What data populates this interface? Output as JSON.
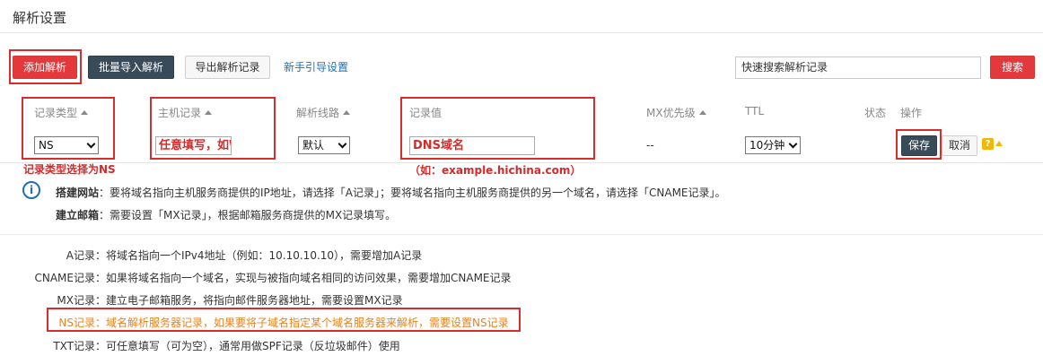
{
  "page": {
    "title": "解析设置"
  },
  "toolbar": {
    "add_label": "添加解析",
    "batch_import_label": "批量导入解析",
    "export_label": "导出解析记录",
    "guide_label": "新手引导设置",
    "search_value": "快速搜索解析记录",
    "search_button_label": "搜索"
  },
  "table": {
    "headers": {
      "record_type": "记录类型",
      "host": "主机记录",
      "line": "解析线路",
      "value": "记录值",
      "mx_priority": "MX优先级",
      "ttl": "TTL",
      "status": "状态",
      "actions": "操作"
    },
    "edit_row": {
      "record_type": "NS",
      "host": "任意填写，如WWW",
      "line": "默认",
      "value": "DNS域名",
      "mx_priority": "--",
      "ttl": "10分钟",
      "save_label": "保存",
      "cancel_label": "取消",
      "help_glyph": "?"
    }
  },
  "annotations": {
    "record_type_note": "记录类型选择为NS",
    "value_note": "（如：example.hichina.com）"
  },
  "info": {
    "icon_glyph": "i",
    "website_title": "搭建网站",
    "website_text": "：要将域名指向主机服务商提供的IP地址，请选择「A记录」；要将域名指向主机服务商提供的另一个域名，请选择「CNAME记录」。",
    "mail_title": "建立邮箱",
    "mail_text": "：需要设置「MX记录」，根据邮箱服务商提供的MX记录填写。"
  },
  "record_types": [
    {
      "name": "A记录",
      "desc": "：将域名指向一个IPv4地址（例如：10.10.10.10），需要增加A记录"
    },
    {
      "name": "CNAME记录",
      "desc": "：如果将域名指向一个域名，实现与被指向域名相同的访问效果，需要增加CNAME记录"
    },
    {
      "name": "MX记录",
      "desc": "：建立电子邮箱服务，将指向邮件服务器地址，需要设置MX记录"
    },
    {
      "name": "NS记录",
      "desc": "：域名解析服务器记录，如果要将子域名指定某个域名服务器来解析，需要设置NS记录"
    },
    {
      "name": "TXT记录",
      "desc": "：可任意填写（可为空），通常用做SPF记录（反垃圾邮件）使用"
    }
  ],
  "colors": {
    "primary_red": "#e4393c",
    "dark_button": "#394a59",
    "link_blue": "#1e6fb8",
    "annotation_red": "#d42b2b",
    "highlight_orange": "#e8821c"
  }
}
